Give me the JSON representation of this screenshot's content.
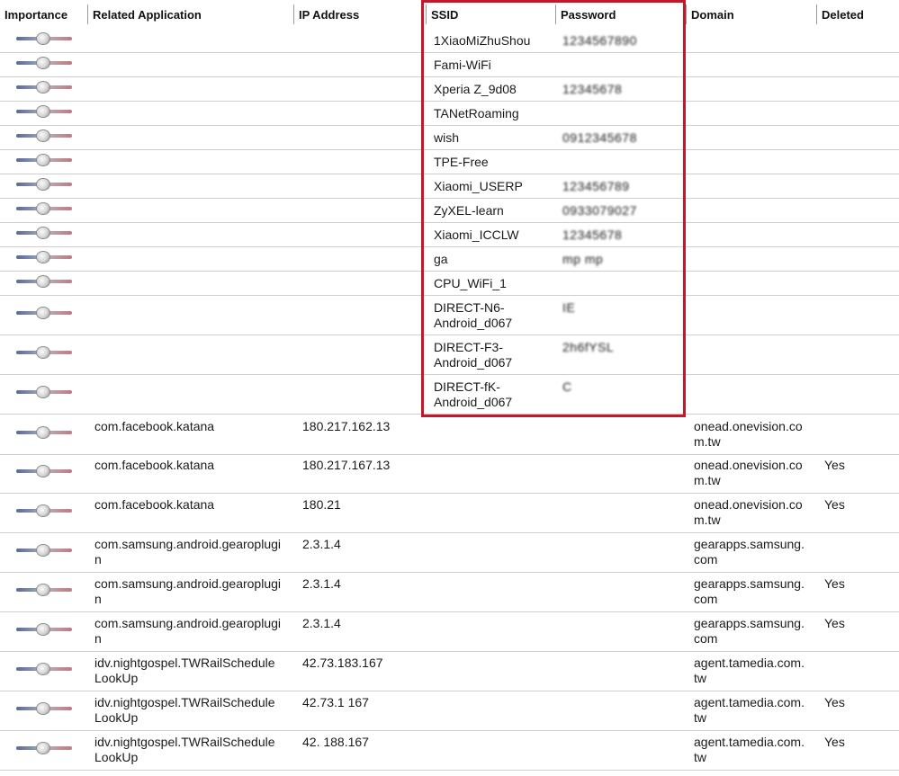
{
  "headers": {
    "importance": "Importance",
    "related_application": "Related Application",
    "ip_address": "IP Address",
    "ssid": "SSID",
    "password": "Password",
    "domain": "Domain",
    "deleted": "Deleted"
  },
  "colors": {
    "highlight_border": "#c4182a",
    "row_divider": "#cfcfcf"
  },
  "importance_icon": "importance-slider",
  "wifi_rows": [
    {
      "ssid": "1XiaoMiZhuShou",
      "password": "1234567890"
    },
    {
      "ssid": "Fami-WiFi",
      "password": ""
    },
    {
      "ssid": "Xperia Z_9d08",
      "password": "12345678"
    },
    {
      "ssid": "TANetRoaming",
      "password": ""
    },
    {
      "ssid": "wish",
      "password": "0912345678"
    },
    {
      "ssid": "TPE-Free",
      "password": ""
    },
    {
      "ssid": "Xiaomi_USERP",
      "password": "123456789"
    },
    {
      "ssid": "ZyXEL-learn",
      "password": "0933079027"
    },
    {
      "ssid": "Xiaomi_ICCLW",
      "password": "12345678"
    },
    {
      "ssid": "ga",
      "password": "mp   mp"
    },
    {
      "ssid": "CPU_WiFi_1",
      "password": ""
    },
    {
      "ssid": "DIRECT-N6-\nAndroid_d067",
      "password": "IE   "
    },
    {
      "ssid": "DIRECT-F3-\nAndroid_d067",
      "password": "2h6fYSL"
    },
    {
      "ssid": "DIRECT-fK-\nAndroid_d067",
      "password": "C"
    }
  ],
  "app_rows": [
    {
      "app": "com.facebook.katana",
      "ip": "180.217.162.13",
      "domain": "onead.onevision.co\nm.tw",
      "deleted": ""
    },
    {
      "app": "com.facebook.katana",
      "ip": "180.217.167.13",
      "domain": "onead.onevision.co\nm.tw",
      "deleted": "Yes"
    },
    {
      "app": "com.facebook.katana",
      "ip": "180.21",
      "domain": "onead.onevision.co\nm.tw",
      "deleted": "Yes"
    },
    {
      "app": "com.samsung.android.gearoplugi\nn",
      "ip": "2.3.1.4",
      "domain": "gearapps.samsung.\ncom",
      "deleted": ""
    },
    {
      "app": "com.samsung.android.gearoplugi\nn",
      "ip": "2.3.1.4",
      "domain": "gearapps.samsung.\ncom",
      "deleted": "Yes"
    },
    {
      "app": "com.samsung.android.gearoplugi\nn",
      "ip": "2.3.1.4",
      "domain": "gearapps.samsung.\ncom",
      "deleted": "Yes"
    },
    {
      "app": "idv.nightgospel.TWRailSchedule\nLookUp",
      "ip": "42.73.183.167",
      "domain": "agent.tamedia.com.\ntw",
      "deleted": ""
    },
    {
      "app": "idv.nightgospel.TWRailSchedule\nLookUp",
      "ip": "42.73.1  167",
      "domain": "agent.tamedia.com.\ntw",
      "deleted": "Yes"
    },
    {
      "app": "idv.nightgospel.TWRailSchedule\nLookUp",
      "ip": "42.   188.167",
      "domain": "agent.tamedia.com.\ntw",
      "deleted": "Yes"
    }
  ]
}
